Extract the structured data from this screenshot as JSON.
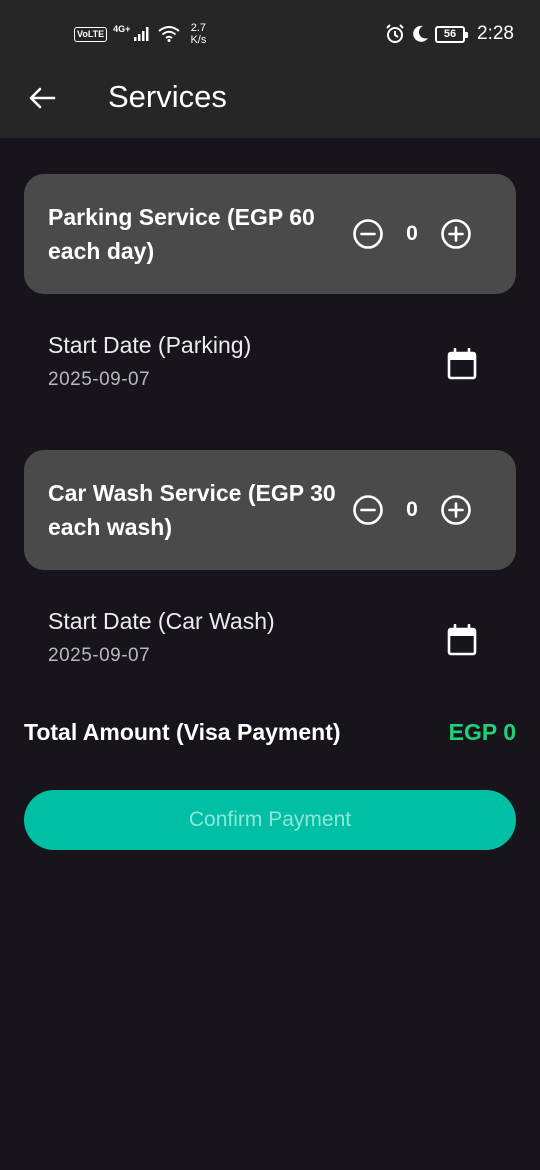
{
  "status_bar": {
    "volte": "VoLTE",
    "network": "4G+",
    "speed_value": "2.7",
    "speed_unit": "K/s",
    "battery": "56",
    "time": "2:28"
  },
  "app_bar": {
    "title": "Services"
  },
  "services": [
    {
      "title": "Parking Service (EGP 60 each day)",
      "quantity": "0",
      "date_label": "Start Date (Parking)",
      "date_value": "2025-09-07"
    },
    {
      "title": "Car Wash Service (EGP 30 each wash)",
      "quantity": "0",
      "date_label": "Start Date (Car Wash)",
      "date_value": "2025-09-07"
    }
  ],
  "total": {
    "label": "Total Amount (Visa Payment)",
    "value": "EGP 0"
  },
  "confirm_label": "Confirm Payment",
  "colors": {
    "background": "#17151b",
    "card": "#4a4a4a",
    "accent": "#00bfa5",
    "total": "#1fd17a"
  }
}
